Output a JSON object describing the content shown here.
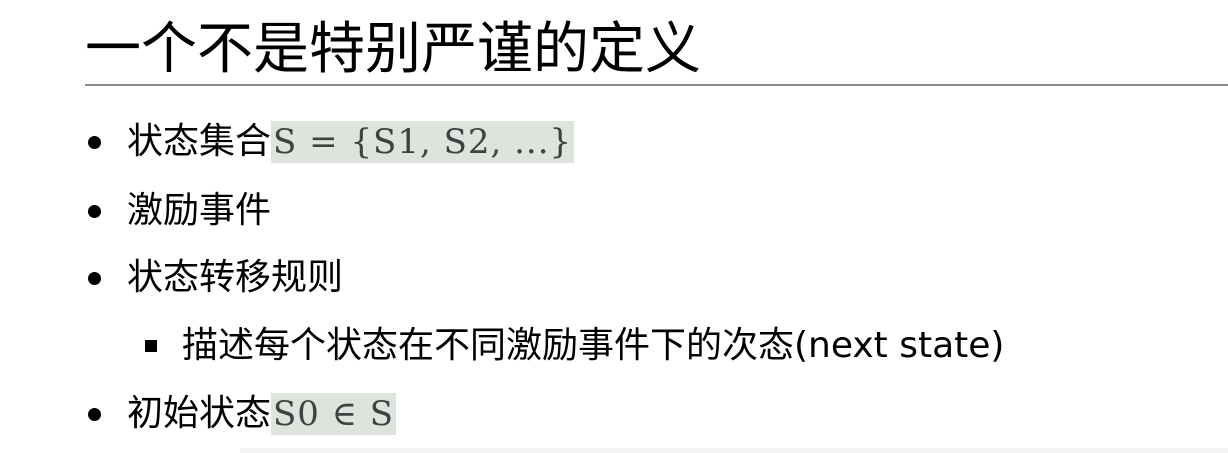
{
  "slide": {
    "title": "一个不是特别严谨的定义",
    "bullets": [
      {
        "text": "状态集合",
        "math": "S = {S1, S2, ...}"
      },
      {
        "text": "激励事件"
      },
      {
        "text": "状态转移规则"
      },
      {
        "text": "描述每个状态在不同激励事件下的次态(next state)"
      },
      {
        "text": "初始状态",
        "math": "S0 ∈ S"
      }
    ]
  }
}
